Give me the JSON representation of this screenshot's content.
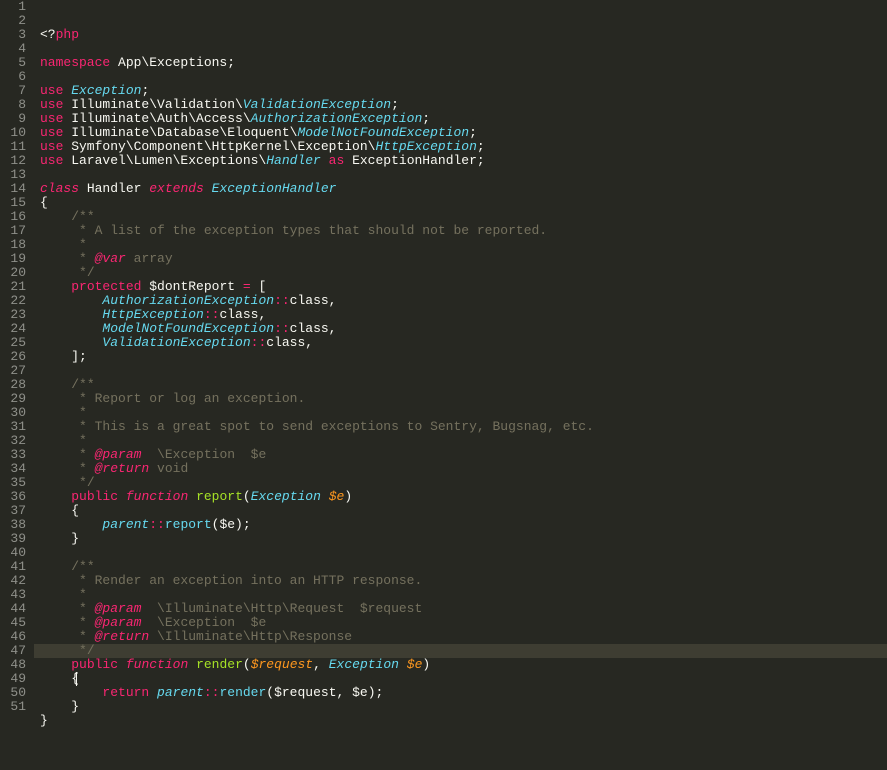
{
  "highlight_line": 47,
  "cursor": {
    "line": 47,
    "col": 5
  },
  "lines": [
    {
      "num": 1,
      "tokens": [
        [
          "plain",
          "<?"
        ],
        [
          "kw",
          "php"
        ]
      ]
    },
    {
      "num": 2,
      "tokens": []
    },
    {
      "num": 3,
      "tokens": [
        [
          "kw",
          "namespace"
        ],
        [
          "plain",
          " App\\Exceptions;"
        ]
      ]
    },
    {
      "num": 4,
      "tokens": []
    },
    {
      "num": 5,
      "tokens": [
        [
          "kw",
          "use"
        ],
        [
          "plain",
          " "
        ],
        [
          "cls",
          "Exception"
        ],
        [
          "plain",
          ";"
        ]
      ]
    },
    {
      "num": 6,
      "tokens": [
        [
          "kw",
          "use"
        ],
        [
          "plain",
          " Illuminate\\Validation\\"
        ],
        [
          "cls",
          "ValidationException"
        ],
        [
          "plain",
          ";"
        ]
      ]
    },
    {
      "num": 7,
      "tokens": [
        [
          "kw",
          "use"
        ],
        [
          "plain",
          " Illuminate\\Auth\\Access\\"
        ],
        [
          "cls",
          "AuthorizationException"
        ],
        [
          "plain",
          ";"
        ]
      ]
    },
    {
      "num": 8,
      "tokens": [
        [
          "kw",
          "use"
        ],
        [
          "plain",
          " Illuminate\\Database\\Eloquent\\"
        ],
        [
          "cls",
          "ModelNotFoundException"
        ],
        [
          "plain",
          ";"
        ]
      ]
    },
    {
      "num": 9,
      "tokens": [
        [
          "kw",
          "use"
        ],
        [
          "plain",
          " Symfony\\Component\\HttpKernel\\Exception\\"
        ],
        [
          "cls",
          "HttpException"
        ],
        [
          "plain",
          ";"
        ]
      ]
    },
    {
      "num": 10,
      "tokens": [
        [
          "kw",
          "use"
        ],
        [
          "plain",
          " Laravel\\Lumen\\Exceptions\\"
        ],
        [
          "cls",
          "Handler"
        ],
        [
          "plain",
          " "
        ],
        [
          "kw",
          "as"
        ],
        [
          "plain",
          " ExceptionHandler;"
        ]
      ]
    },
    {
      "num": 11,
      "tokens": []
    },
    {
      "num": 12,
      "tokens": [
        [
          "kw-it",
          "class"
        ],
        [
          "plain",
          " Handler "
        ],
        [
          "kw-it",
          "extends"
        ],
        [
          "plain",
          " "
        ],
        [
          "cls",
          "ExceptionHandler"
        ]
      ]
    },
    {
      "num": 13,
      "tokens": [
        [
          "plain",
          "{"
        ]
      ]
    },
    {
      "num": 14,
      "tokens": [
        [
          "plain",
          "    "
        ],
        [
          "com",
          "/**"
        ]
      ]
    },
    {
      "num": 15,
      "tokens": [
        [
          "plain",
          "    "
        ],
        [
          "com",
          " * A list of the exception types that should not be reported."
        ]
      ]
    },
    {
      "num": 16,
      "tokens": [
        [
          "plain",
          "    "
        ],
        [
          "com",
          " *"
        ]
      ]
    },
    {
      "num": 17,
      "tokens": [
        [
          "plain",
          "    "
        ],
        [
          "com",
          " * "
        ],
        [
          "tag",
          "@var"
        ],
        [
          "com",
          " array"
        ]
      ]
    },
    {
      "num": 18,
      "tokens": [
        [
          "plain",
          "    "
        ],
        [
          "com",
          " */"
        ]
      ]
    },
    {
      "num": 19,
      "tokens": [
        [
          "plain",
          "    "
        ],
        [
          "kw",
          "protected"
        ],
        [
          "plain",
          " $dontReport "
        ],
        [
          "op",
          "="
        ],
        [
          "plain",
          " ["
        ]
      ]
    },
    {
      "num": 20,
      "tokens": [
        [
          "plain",
          "        "
        ],
        [
          "cls",
          "AuthorizationException"
        ],
        [
          "op",
          "::"
        ],
        [
          "plain",
          "class,"
        ]
      ]
    },
    {
      "num": 21,
      "tokens": [
        [
          "plain",
          "        "
        ],
        [
          "cls",
          "HttpException"
        ],
        [
          "op",
          "::"
        ],
        [
          "plain",
          "class,"
        ]
      ]
    },
    {
      "num": 22,
      "tokens": [
        [
          "plain",
          "        "
        ],
        [
          "cls",
          "ModelNotFoundException"
        ],
        [
          "op",
          "::"
        ],
        [
          "plain",
          "class,"
        ]
      ]
    },
    {
      "num": 23,
      "tokens": [
        [
          "plain",
          "        "
        ],
        [
          "cls",
          "ValidationException"
        ],
        [
          "op",
          "::"
        ],
        [
          "plain",
          "class,"
        ]
      ]
    },
    {
      "num": 24,
      "tokens": [
        [
          "plain",
          "    ];"
        ]
      ]
    },
    {
      "num": 25,
      "tokens": []
    },
    {
      "num": 26,
      "tokens": [
        [
          "plain",
          "    "
        ],
        [
          "com",
          "/**"
        ]
      ]
    },
    {
      "num": 27,
      "tokens": [
        [
          "plain",
          "    "
        ],
        [
          "com",
          " * Report or log an exception."
        ]
      ]
    },
    {
      "num": 28,
      "tokens": [
        [
          "plain",
          "    "
        ],
        [
          "com",
          " *"
        ]
      ]
    },
    {
      "num": 29,
      "tokens": [
        [
          "plain",
          "    "
        ],
        [
          "com",
          " * This is a great spot to send exceptions to Sentry, Bugsnag, etc."
        ]
      ]
    },
    {
      "num": 30,
      "tokens": [
        [
          "plain",
          "    "
        ],
        [
          "com",
          " *"
        ]
      ]
    },
    {
      "num": 31,
      "tokens": [
        [
          "plain",
          "    "
        ],
        [
          "com",
          " * "
        ],
        [
          "tag",
          "@param"
        ],
        [
          "com",
          "  \\Exception  $e"
        ]
      ]
    },
    {
      "num": 32,
      "tokens": [
        [
          "plain",
          "    "
        ],
        [
          "com",
          " * "
        ],
        [
          "tag",
          "@return"
        ],
        [
          "com",
          " void"
        ]
      ]
    },
    {
      "num": 33,
      "tokens": [
        [
          "plain",
          "    "
        ],
        [
          "com",
          " */"
        ]
      ]
    },
    {
      "num": 34,
      "tokens": [
        [
          "plain",
          "    "
        ],
        [
          "kw",
          "public"
        ],
        [
          "plain",
          " "
        ],
        [
          "kw-it",
          "function"
        ],
        [
          "plain",
          " "
        ],
        [
          "fn",
          "report"
        ],
        [
          "plain",
          "("
        ],
        [
          "cls",
          "Exception"
        ],
        [
          "plain",
          " "
        ],
        [
          "var",
          "$e"
        ],
        [
          "plain",
          ")"
        ]
      ]
    },
    {
      "num": 35,
      "tokens": [
        [
          "plain",
          "    {"
        ]
      ]
    },
    {
      "num": 36,
      "tokens": [
        [
          "plain",
          "        "
        ],
        [
          "cls",
          "parent"
        ],
        [
          "op",
          "::"
        ],
        [
          "fnCall",
          "report"
        ],
        [
          "plain",
          "($e);"
        ]
      ]
    },
    {
      "num": 37,
      "tokens": [
        [
          "plain",
          "    }"
        ]
      ]
    },
    {
      "num": 38,
      "tokens": []
    },
    {
      "num": 39,
      "tokens": [
        [
          "plain",
          "    "
        ],
        [
          "com",
          "/**"
        ]
      ]
    },
    {
      "num": 40,
      "tokens": [
        [
          "plain",
          "    "
        ],
        [
          "com",
          " * Render an exception into an HTTP response."
        ]
      ]
    },
    {
      "num": 41,
      "tokens": [
        [
          "plain",
          "    "
        ],
        [
          "com",
          " *"
        ]
      ]
    },
    {
      "num": 42,
      "tokens": [
        [
          "plain",
          "    "
        ],
        [
          "com",
          " * "
        ],
        [
          "tag",
          "@param"
        ],
        [
          "com",
          "  \\Illuminate\\Http\\Request  $request"
        ]
      ]
    },
    {
      "num": 43,
      "tokens": [
        [
          "plain",
          "    "
        ],
        [
          "com",
          " * "
        ],
        [
          "tag",
          "@param"
        ],
        [
          "com",
          "  \\Exception  $e"
        ]
      ]
    },
    {
      "num": 44,
      "tokens": [
        [
          "plain",
          "    "
        ],
        [
          "com",
          " * "
        ],
        [
          "tag",
          "@return"
        ],
        [
          "com",
          " \\Illuminate\\Http\\Response"
        ]
      ]
    },
    {
      "num": 45,
      "tokens": [
        [
          "plain",
          "    "
        ],
        [
          "com",
          " */"
        ]
      ]
    },
    {
      "num": 46,
      "tokens": [
        [
          "plain",
          "    "
        ],
        [
          "kw",
          "public"
        ],
        [
          "plain",
          " "
        ],
        [
          "kw-it",
          "function"
        ],
        [
          "plain",
          " "
        ],
        [
          "fn",
          "render"
        ],
        [
          "plain",
          "("
        ],
        [
          "var",
          "$request"
        ],
        [
          "plain",
          ", "
        ],
        [
          "cls",
          "Exception"
        ],
        [
          "plain",
          " "
        ],
        [
          "var",
          "$e"
        ],
        [
          "plain",
          ")"
        ]
      ]
    },
    {
      "num": 47,
      "tokens": [
        [
          "plain",
          "    {"
        ]
      ]
    },
    {
      "num": 48,
      "tokens": [
        [
          "plain",
          "        "
        ],
        [
          "kw",
          "return"
        ],
        [
          "plain",
          " "
        ],
        [
          "cls",
          "parent"
        ],
        [
          "op",
          "::"
        ],
        [
          "fnCall",
          "render"
        ],
        [
          "plain",
          "($request, $e);"
        ]
      ]
    },
    {
      "num": 49,
      "tokens": [
        [
          "plain",
          "    }"
        ]
      ]
    },
    {
      "num": 50,
      "tokens": [
        [
          "plain",
          "}"
        ]
      ]
    },
    {
      "num": 51,
      "tokens": []
    }
  ]
}
